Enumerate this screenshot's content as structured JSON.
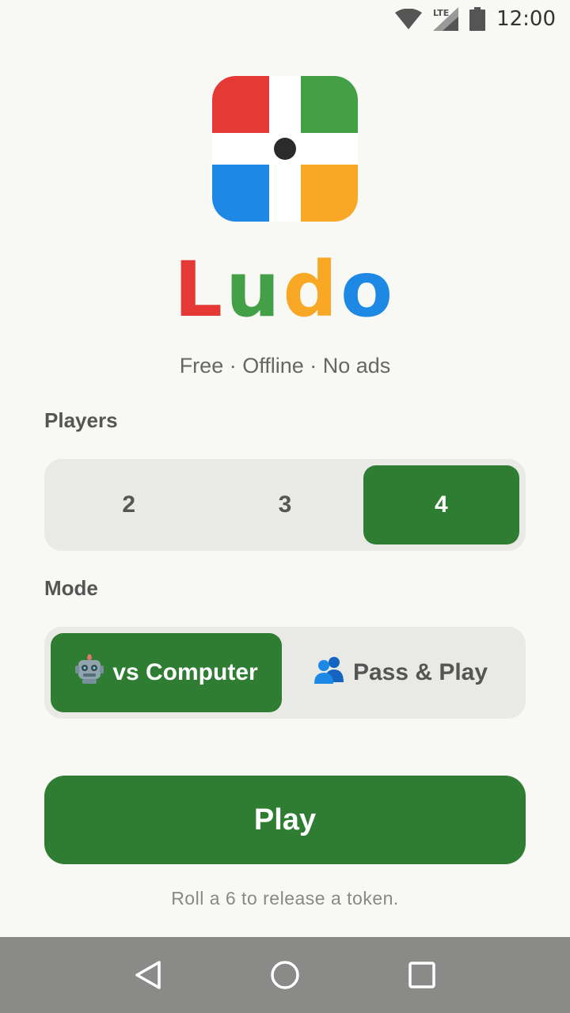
{
  "status_bar": {
    "time": "12:00",
    "network": "LTE",
    "icons": [
      "wifi-icon",
      "signal-icon",
      "battery-icon"
    ]
  },
  "app": {
    "title_letters": [
      "L",
      "u",
      "d",
      "o"
    ],
    "subtitle": "Free · Offline · No ads",
    "logo_colors": {
      "red": "#e53935",
      "green": "#43a047",
      "blue": "#1e88e5",
      "yellow": "#f9a825"
    }
  },
  "players": {
    "label": "Players",
    "options": [
      "2",
      "3",
      "4"
    ],
    "selected": "4"
  },
  "mode": {
    "label": "Mode",
    "options": [
      {
        "icon": "robot-icon",
        "label": "vs Computer"
      },
      {
        "icon": "people-icon",
        "label": "Pass & Play"
      }
    ],
    "selected": "vs Computer"
  },
  "play_button": {
    "label": "Play"
  },
  "hint": "Roll a 6 to release a token.",
  "nav": {
    "icons": [
      "back-icon",
      "home-icon",
      "recents-icon"
    ]
  },
  "colors": {
    "accent": "#2e7d32",
    "background": "#f8f8f5",
    "segment_bg": "#e9e9e5"
  }
}
